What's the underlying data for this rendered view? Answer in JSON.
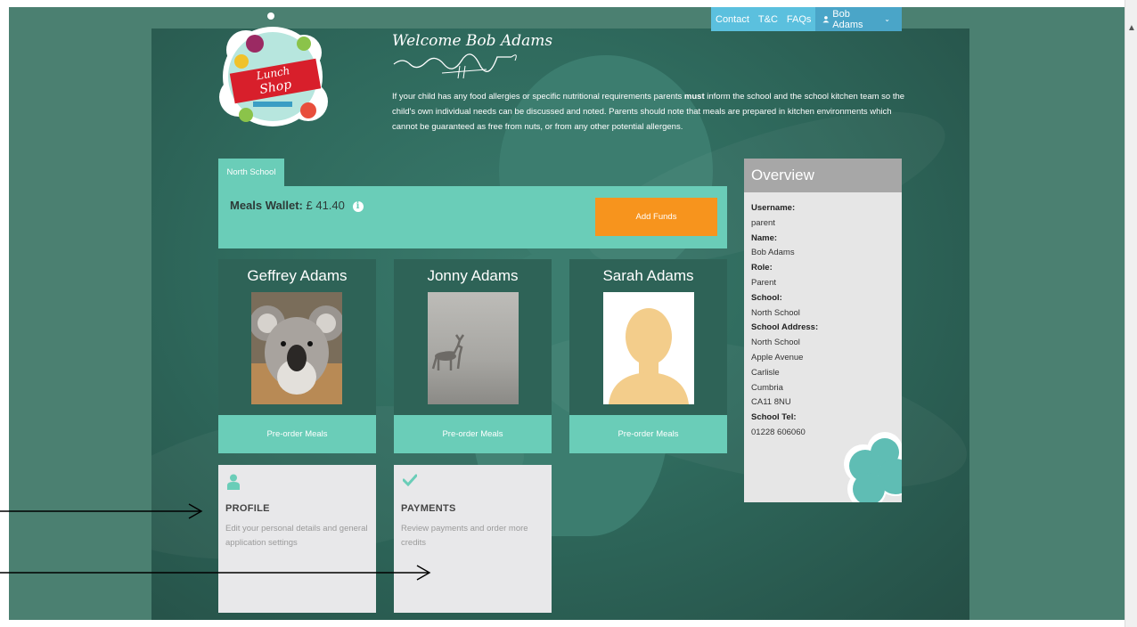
{
  "nav": {
    "contact": "Contact",
    "tc": "T&C",
    "faqs": "FAQs",
    "user": "Bob Adams"
  },
  "logo": {
    "text1": "Lunch",
    "text2": "Shop"
  },
  "welcome": "Welcome Bob Adams",
  "allergy": {
    "part1": "If your child has any food allergies or specific nutritional requirements parents ",
    "bold": "must",
    "part2": " inform the school and the school kitchen team so the child's own individual needs can be discussed and noted. Parents should note that meals are prepared in kitchen environments which cannot be guaranteed as free from nuts, or from any other potential allergens."
  },
  "school_tab": "North School",
  "wallet": {
    "label": "Meals Wallet:",
    "amount": "£ 41.40",
    "add_funds": "Add Funds"
  },
  "children": [
    {
      "name": "Geffrey Adams",
      "action": "Pre-order Meals",
      "photo": "koala"
    },
    {
      "name": "Jonny Adams",
      "action": "Pre-order Meals",
      "photo": "deer-in-fog"
    },
    {
      "name": "Sarah Adams",
      "action": "Pre-order Meals",
      "photo": "avatar-placeholder"
    }
  ],
  "tiles": [
    {
      "title": "PROFILE",
      "desc": "Edit your personal details and general application settings",
      "icon": "user-icon",
      "icon_color": "#6acdb8"
    },
    {
      "title": "PAYMENTS",
      "desc": "Review payments and order more credits",
      "icon": "check-icon",
      "icon_color": "#6acdb8"
    }
  ],
  "overview": {
    "title": "Overview",
    "username_label": "Username:",
    "username": "parent",
    "name_label": "Name:",
    "name": "Bob Adams",
    "role_label": "Role:",
    "role": "Parent",
    "school_label": "School:",
    "school": "North School",
    "address_label": "School Address:",
    "address": [
      "North School",
      "Apple Avenue",
      "Carlisle",
      "Cumbria",
      "CA11 8NU"
    ],
    "tel_label": "School Tel:",
    "tel": "01228 606060"
  },
  "colors": {
    "accent": "#6acdb8",
    "button": "#f7941d",
    "nav": "#5bc0de",
    "panel": "#2f6a5d"
  }
}
